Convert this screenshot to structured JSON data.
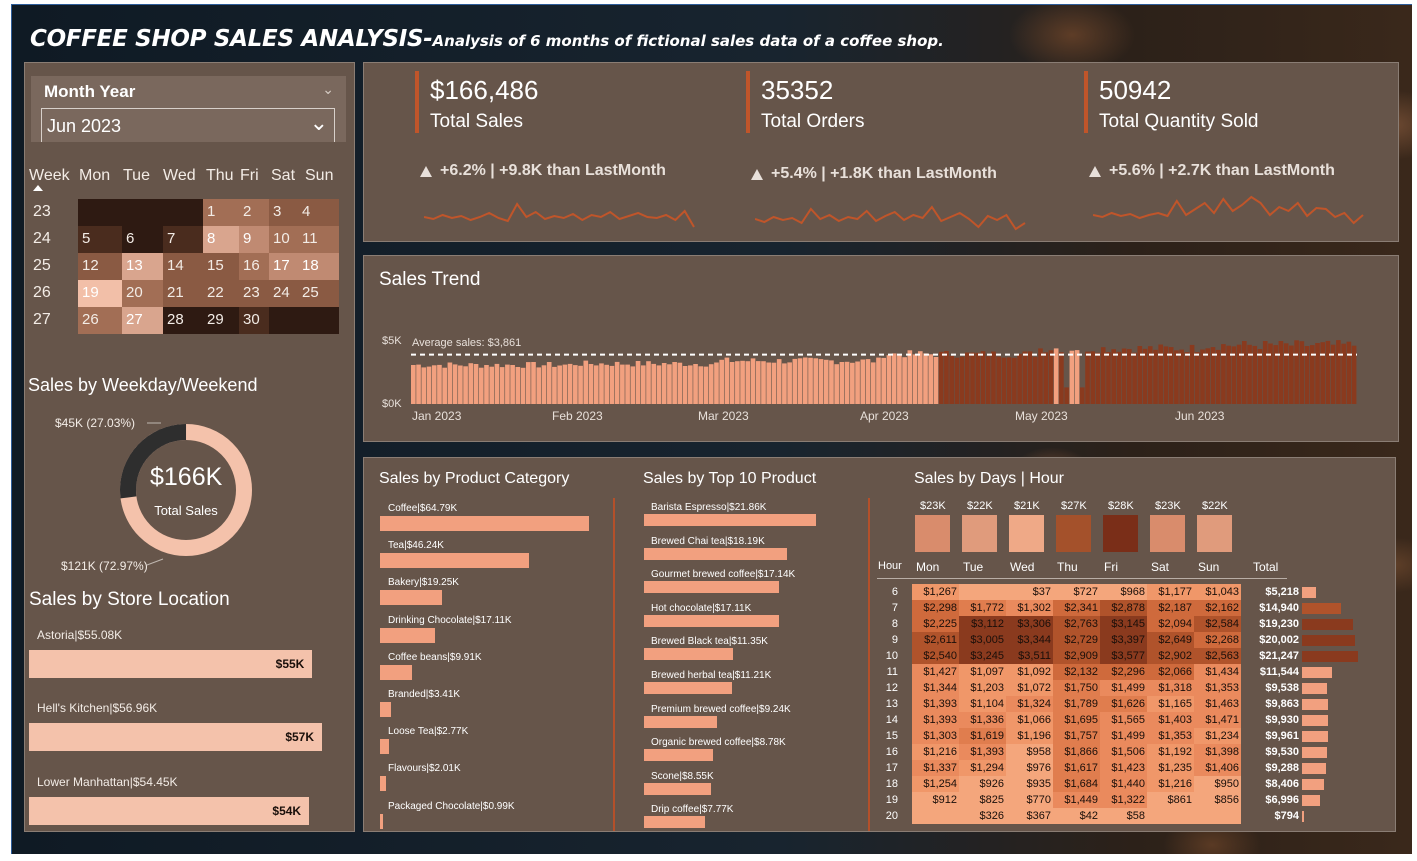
{
  "header": {
    "title": "COFFEE SHOP SALES ANALYSIS-",
    "subtitle": "Analysis of 6 months of fictional sales data of a coffee shop."
  },
  "slicer": {
    "label": "Month Year",
    "selected": "Jun 2023"
  },
  "calendar": {
    "headers": [
      "Week",
      "Mon",
      "Tue",
      "Wed",
      "Thu",
      "Fri",
      "Sat",
      "Sun"
    ],
    "weeks": [
      {
        "week": "23",
        "days": [
          "",
          "",
          "",
          "1",
          "2",
          "3",
          "4"
        ],
        "colors": [
          "#2e1a12",
          "#2e1a12",
          "#2e1a12",
          "#a26e55",
          "#a26e55",
          "#8a5a43",
          "#8a5a43"
        ]
      },
      {
        "week": "24",
        "days": [
          "5",
          "6",
          "7",
          "8",
          "9",
          "10",
          "11"
        ],
        "colors": [
          "#4a2c1e",
          "#2e1a12",
          "#4a2c1e",
          "#d9a58e",
          "#c08a72",
          "#a26e55",
          "#a26e55"
        ]
      },
      {
        "week": "25",
        "days": [
          "12",
          "13",
          "14",
          "15",
          "16",
          "17",
          "18"
        ],
        "colors": [
          "#8a5a43",
          "#d9a58e",
          "#8a5a43",
          "#8a5a43",
          "#a26e55",
          "#c08a72",
          "#c08a72"
        ]
      },
      {
        "week": "26",
        "days": [
          "19",
          "20",
          "21",
          "22",
          "23",
          "24",
          "25"
        ],
        "colors": [
          "#f2bfa8",
          "#a26e55",
          "#8a5a43",
          "#8a5a43",
          "#8a5a43",
          "#8a5a43",
          "#8a5a43"
        ]
      },
      {
        "week": "27",
        "days": [
          "26",
          "27",
          "28",
          "29",
          "30",
          "",
          ""
        ],
        "colors": [
          "#a26e55",
          "#d9a58e",
          "#2e1a12",
          "#2e1a12",
          "#4a2c1e",
          "#2e1a12",
          "#2e1a12"
        ]
      }
    ]
  },
  "kpis": [
    {
      "value": "$166,486",
      "label": "Total Sales",
      "change": "+6.2% | +9.8K than LastMonth",
      "spark": [
        20,
        18,
        22,
        19,
        21,
        17,
        20,
        24,
        19,
        16,
        33,
        20,
        25,
        18,
        21,
        19,
        23,
        17,
        22,
        20,
        25,
        18,
        21,
        24,
        20,
        19,
        22,
        17,
        26,
        10
      ]
    },
    {
      "value": "35352",
      "label": "Total Orders",
      "change": "+5.4% | +1.8K than LastMonth",
      "spark": [
        18,
        15,
        20,
        17,
        19,
        14,
        28,
        18,
        22,
        16,
        20,
        18,
        26,
        16,
        21,
        25,
        17,
        22,
        19,
        30,
        16,
        20,
        24,
        18,
        10,
        21,
        17,
        22,
        8,
        14
      ]
    },
    {
      "value": "50942",
      "label": "Total Quantity Sold",
      "change": "+5.6% | +2.7K than LastMonth",
      "spark": [
        18,
        16,
        20,
        17,
        19,
        15,
        18,
        20,
        17,
        32,
        18,
        24,
        30,
        20,
        34,
        22,
        28,
        36,
        30,
        18,
        26,
        22,
        30,
        17,
        25,
        24,
        16,
        20,
        10,
        18
      ]
    }
  ],
  "sales_trend": {
    "title": "Sales Trend",
    "avg_label": "Average sales: $3,861",
    "y_top": "$5K",
    "y_bottom": "$0K",
    "months": [
      "Jan 2023",
      "Feb 2023",
      "Mar 2023",
      "Apr 2023",
      "May 2023",
      "Jun 2023"
    ]
  },
  "weekday_weekend": {
    "title": "Sales by Weekday/Weekend",
    "center_value": "$166K",
    "center_label": "Total Sales",
    "weekend_label": "$45K (27.03%)",
    "weekday_label": "$121K (72.97%)",
    "weekend_pct": 27.03,
    "colors": {
      "weekend": "#2e2e2e",
      "weekday": "#f4c2ab"
    }
  },
  "store_location": {
    "title": "Sales by Store Location",
    "stores": [
      {
        "label": "Astoria|$55.08K",
        "value": "$55K",
        "num": 55.08
      },
      {
        "label": "Hell's Kitchen|$56.96K",
        "value": "$57K",
        "num": 56.96
      },
      {
        "label": "Lower Manhattan|$54.45K",
        "value": "$54K",
        "num": 54.45
      }
    ]
  },
  "product_category": {
    "title": "Sales by Product Category",
    "items": [
      {
        "label": "Coffee|$64.79K",
        "num": 64.79
      },
      {
        "label": "Tea|$46.24K",
        "num": 46.24
      },
      {
        "label": "Bakery|$19.25K",
        "num": 19.25
      },
      {
        "label": "Drinking Chocolate|$17.11K",
        "num": 17.11
      },
      {
        "label": "Coffee beans|$9.91K",
        "num": 9.91
      },
      {
        "label": "Branded|$3.41K",
        "num": 3.41
      },
      {
        "label": "Loose Tea|$2.77K",
        "num": 2.77
      },
      {
        "label": "Flavours|$2.01K",
        "num": 2.01
      },
      {
        "label": "Packaged Chocolate|$0.99K",
        "num": 0.99
      }
    ]
  },
  "top_products": {
    "title": "Sales by Top 10 Product",
    "items": [
      {
        "label": "Barista Espresso|$21.86K",
        "num": 21.86
      },
      {
        "label": "Brewed Chai tea|$18.19K",
        "num": 18.19
      },
      {
        "label": "Gourmet brewed coffee|$17.14K",
        "num": 17.14
      },
      {
        "label": "Hot chocolate|$17.11K",
        "num": 17.11
      },
      {
        "label": "Brewed Black tea|$11.35K",
        "num": 11.35
      },
      {
        "label": "Brewed herbal tea|$11.21K",
        "num": 11.21
      },
      {
        "label": "Premium brewed coffee|$9.24K",
        "num": 9.24
      },
      {
        "label": "Organic brewed coffee|$8.78K",
        "num": 8.78
      },
      {
        "label": "Scone|$8.55K",
        "num": 8.55
      },
      {
        "label": "Drip coffee|$7.77K",
        "num": 7.77
      }
    ]
  },
  "days_hour": {
    "title": "Sales by Days | Hour",
    "day_totals": [
      {
        "label": "$23K",
        "color": "#d98c6c"
      },
      {
        "label": "$22K",
        "color": "#e09b7c"
      },
      {
        "label": "$21K",
        "color": "#efa987"
      },
      {
        "label": "$27K",
        "color": "#a4512b"
      },
      {
        "label": "$28K",
        "color": "#7a2e18"
      },
      {
        "label": "$23K",
        "color": "#d98c6c"
      },
      {
        "label": "$22K",
        "color": "#e09b7c"
      }
    ],
    "header_hour": "Hour",
    "days": [
      "Mon",
      "Tue",
      "Wed",
      "Thu",
      "Fri",
      "Sat",
      "Sun"
    ],
    "header_total": "Total",
    "rows": [
      {
        "hour": "6",
        "cells": [
          "$1,267",
          "",
          "$37",
          "$727",
          "$968",
          "$1,177",
          "$1,043"
        ],
        "total": "$5,218",
        "num": 5218
      },
      {
        "hour": "7",
        "cells": [
          "$2,298",
          "$1,772",
          "$1,302",
          "$2,341",
          "$2,878",
          "$2,187",
          "$2,162"
        ],
        "total": "$14,940",
        "num": 14940
      },
      {
        "hour": "8",
        "cells": [
          "$2,225",
          "$3,112",
          "$3,306",
          "$2,763",
          "$3,145",
          "$2,094",
          "$2,584"
        ],
        "total": "$19,230",
        "num": 19230
      },
      {
        "hour": "9",
        "cells": [
          "$2,611",
          "$3,005",
          "$3,344",
          "$2,729",
          "$3,397",
          "$2,649",
          "$2,268"
        ],
        "total": "$20,002",
        "num": 20002
      },
      {
        "hour": "10",
        "cells": [
          "$2,540",
          "$3,245",
          "$3,511",
          "$2,909",
          "$3,577",
          "$2,902",
          "$2,563"
        ],
        "total": "$21,247",
        "num": 21247
      },
      {
        "hour": "11",
        "cells": [
          "$1,427",
          "$1,097",
          "$1,092",
          "$2,132",
          "$2,296",
          "$2,066",
          "$1,434"
        ],
        "total": "$11,544",
        "num": 11544
      },
      {
        "hour": "12",
        "cells": [
          "$1,344",
          "$1,203",
          "$1,072",
          "$1,750",
          "$1,499",
          "$1,318",
          "$1,353"
        ],
        "total": "$9,538",
        "num": 9538
      },
      {
        "hour": "13",
        "cells": [
          "$1,393",
          "$1,104",
          "$1,324",
          "$1,789",
          "$1,626",
          "$1,165",
          "$1,463"
        ],
        "total": "$9,863",
        "num": 9863
      },
      {
        "hour": "14",
        "cells": [
          "$1,393",
          "$1,336",
          "$1,066",
          "$1,695",
          "$1,565",
          "$1,403",
          "$1,471"
        ],
        "total": "$9,930",
        "num": 9930
      },
      {
        "hour": "15",
        "cells": [
          "$1,303",
          "$1,619",
          "$1,196",
          "$1,757",
          "$1,499",
          "$1,353",
          "$1,234"
        ],
        "total": "$9,961",
        "num": 9961
      },
      {
        "hour": "16",
        "cells": [
          "$1,216",
          "$1,393",
          "$958",
          "$1,866",
          "$1,506",
          "$1,192",
          "$1,398"
        ],
        "total": "$9,530",
        "num": 9530
      },
      {
        "hour": "17",
        "cells": [
          "$1,337",
          "$1,294",
          "$976",
          "$1,617",
          "$1,423",
          "$1,235",
          "$1,406"
        ],
        "total": "$9,288",
        "num": 9288
      },
      {
        "hour": "18",
        "cells": [
          "$1,254",
          "$926",
          "$935",
          "$1,684",
          "$1,440",
          "$1,216",
          "$950"
        ],
        "total": "$8,406",
        "num": 8406
      },
      {
        "hour": "19",
        "cells": [
          "$912",
          "$825",
          "$770",
          "$1,449",
          "$1,322",
          "$861",
          "$856"
        ],
        "total": "$6,996",
        "num": 6996
      },
      {
        "hour": "20",
        "cells": [
          "",
          "$326",
          "$367",
          "$42",
          "$58",
          "",
          ""
        ],
        "total": "$794",
        "num": 794
      }
    ]
  }
}
